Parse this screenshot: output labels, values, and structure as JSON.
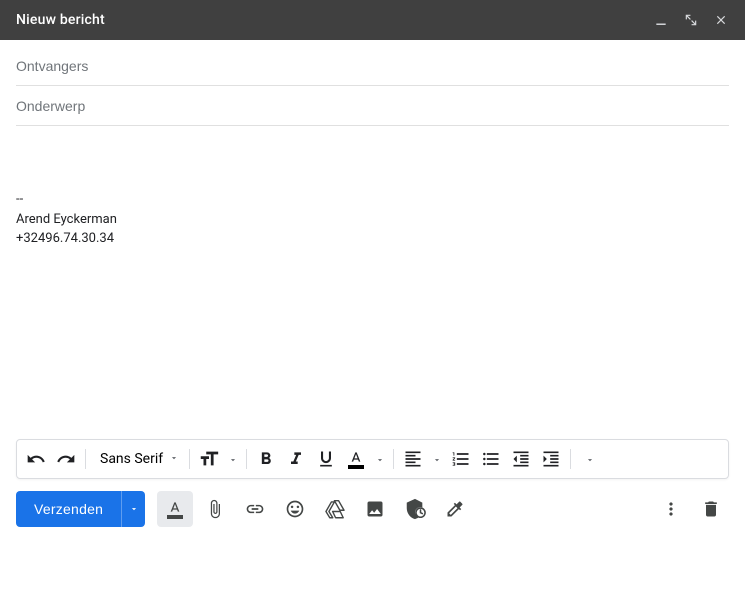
{
  "header": {
    "title": "Nieuw bericht"
  },
  "fields": {
    "recipients_placeholder": "Ontvangers",
    "subject_placeholder": "Onderwerp"
  },
  "signature": {
    "separator": "--",
    "name": "Arend Eyckerman",
    "phone": "+32496.74.30.34"
  },
  "format": {
    "font_family": "Sans Serif"
  },
  "actions": {
    "send_label": "Verzenden"
  }
}
